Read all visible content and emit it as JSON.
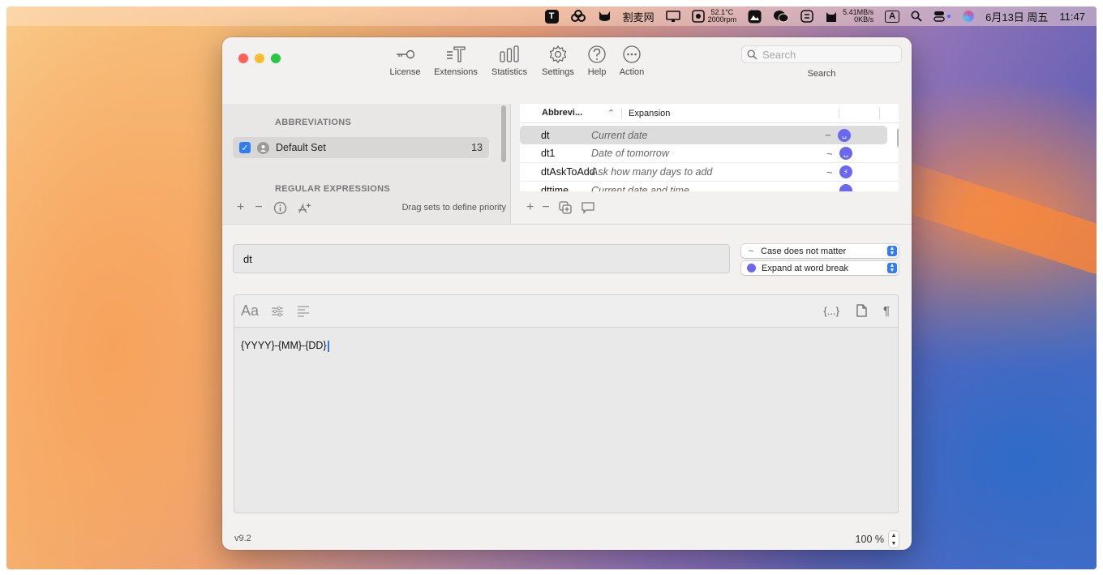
{
  "menubar": {
    "text_app": "T",
    "site_label": "割麦网",
    "temperature": "52.1°C",
    "fan_rpm": "2000rpm",
    "net_up": "5.41MB/s",
    "net_down": "0KB/s",
    "input_method": "A",
    "date": "6月13日 周五",
    "time": "11:47"
  },
  "window": {
    "toolbar": {
      "license": "License",
      "extensions": "Extensions",
      "statistics": "Statistics",
      "settings": "Settings",
      "help": "Help",
      "action": "Action"
    },
    "search": {
      "placeholder": "Search",
      "label": "Search"
    },
    "sets": {
      "header_abbreviations": "ABBREVIATIONS",
      "header_regex": "REGULAR EXPRESSIONS",
      "items": [
        {
          "name": "Default Set",
          "count": "13",
          "checked": true
        }
      ],
      "drag_hint": "Drag sets to define priority"
    },
    "table": {
      "columns": [
        "Abbrevi...",
        "Expansion"
      ],
      "rows": [
        {
          "abbreviation": "dt",
          "expansion": "Current date",
          "case": "~",
          "badge": "space-icon"
        },
        {
          "abbreviation": "dt1",
          "expansion": "Date of tomorrow",
          "case": "~",
          "badge": "space-icon"
        },
        {
          "abbreviation": "dtAskToAdd",
          "expansion": "Ask how many days to add",
          "case": "~",
          "badge": "bolt-icon"
        },
        {
          "abbreviation": "dttime",
          "expansion": "Current date and time",
          "case": "",
          "badge": "space-icon"
        }
      ]
    },
    "editor": {
      "abbreviation_value": "dt",
      "case_option": "Case does not matter",
      "expand_option": "Expand at word break",
      "font_label": "Aa",
      "placeholder_button": "{...}",
      "content": "{YYYY}-{MM}-{DD}"
    },
    "footer": {
      "version": "v9.2",
      "zoom": "100 %"
    }
  },
  "colors": {
    "accent": "#2f7cf6",
    "badge": "#6a67f3",
    "close": "#fe5f57",
    "minimize": "#febc2e",
    "maximize": "#28c840"
  }
}
